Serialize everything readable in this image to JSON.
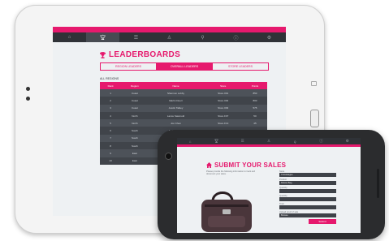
{
  "tablet": {
    "leaderboards": {
      "title": "LEADERBOARDS",
      "tabs": [
        "REGION LEADERS",
        "OVERALL LEADERS",
        "STORE LEADERS"
      ],
      "active_tab": 1,
      "section": "ALL REGIONS",
      "columns": [
        "Rank",
        "Region",
        "Name",
        "Store",
        "Points"
      ],
      "rows": [
        [
          "1",
          "Coast",
          "Shannon Lobby",
          "Store 001",
          "850"
        ],
        [
          "2",
          "Coast",
          "Martin Doerr",
          "Store 002",
          "800"
        ],
        [
          "3",
          "Coast",
          "Austin Talkey",
          "Store 003",
          "575"
        ],
        [
          "4",
          "North",
          "Lance Sawmold",
          "Store F07",
          "50"
        ],
        [
          "5",
          "North",
          "Jon Chen",
          "Store F13",
          "45"
        ],
        [
          "6",
          "South",
          "Jodie Bouker",
          "Store 2091",
          "35"
        ],
        [
          "7",
          "South",
          "Kirsten Park",
          "",
          ""
        ],
        [
          "8",
          "South",
          "Jim Sandpe",
          "",
          ""
        ],
        [
          "9",
          "East",
          "",
          "",
          ""
        ],
        [
          "10",
          "East",
          "",
          "",
          ""
        ]
      ]
    }
  },
  "phone": {
    "title": "SUBMIT YOUR SALES",
    "description": "Please provide the following information to track and document your sales.",
    "form": {
      "fields": [
        {
          "label": "Store",
          "value": "Crossleague"
        },
        {
          "label": "Product",
          "value": "Deluxe Bag"
        },
        {
          "label": "Quantity",
          "value": ""
        },
        {
          "label": "Quantity",
          "value": ""
        },
        {
          "label": "Total",
          "value": ""
        },
        {
          "label": "Upload proof of sale",
          "value": "Browse"
        }
      ],
      "submit_label": "Submit"
    }
  },
  "colors": {
    "accent": "#e6196d",
    "nav": "#2f3237",
    "row_dark": "#40444a",
    "row_light": "#4d5259"
  }
}
